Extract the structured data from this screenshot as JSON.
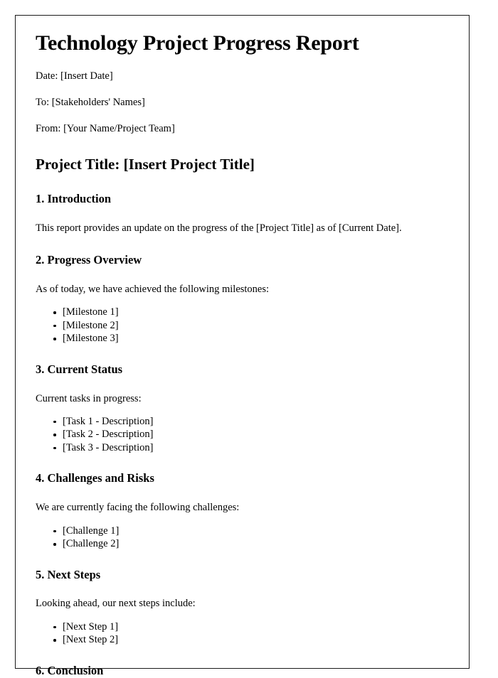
{
  "document": {
    "title": "Technology Project Progress Report",
    "meta": [
      "Date: [Insert Date]",
      "To: [Stakeholders' Names]",
      "From: [Your Name/Project Team]"
    ],
    "project_title_heading": "Project Title: [Insert Project Title]",
    "sections": [
      {
        "heading": "1. Introduction",
        "paragraph": "This report provides an update on the progress of the [Project Title] as of [Current Date]."
      },
      {
        "heading": "2. Progress Overview",
        "paragraph": "As of today, we have achieved the following milestones:",
        "bullets": [
          "[Milestone 1]",
          "[Milestone 2]",
          "[Milestone 3]"
        ]
      },
      {
        "heading": "3. Current Status",
        "paragraph": "Current tasks in progress:",
        "bullets": [
          "[Task 1 - Description]",
          "[Task 2 - Description]",
          "[Task 3 - Description]"
        ]
      },
      {
        "heading": "4. Challenges and Risks",
        "paragraph": "We are currently facing the following challenges:",
        "bullets": [
          "[Challenge 1]",
          "[Challenge 2]"
        ]
      },
      {
        "heading": "5. Next Steps",
        "paragraph": "Looking ahead, our next steps include:",
        "bullets": [
          "[Next Step 1]",
          "[Next Step 2]"
        ]
      },
      {
        "heading": "6. Conclusion"
      }
    ]
  },
  "colors": {
    "page_background": "#ffffff",
    "page_border": "#1a1a1a",
    "text": "#000000"
  }
}
